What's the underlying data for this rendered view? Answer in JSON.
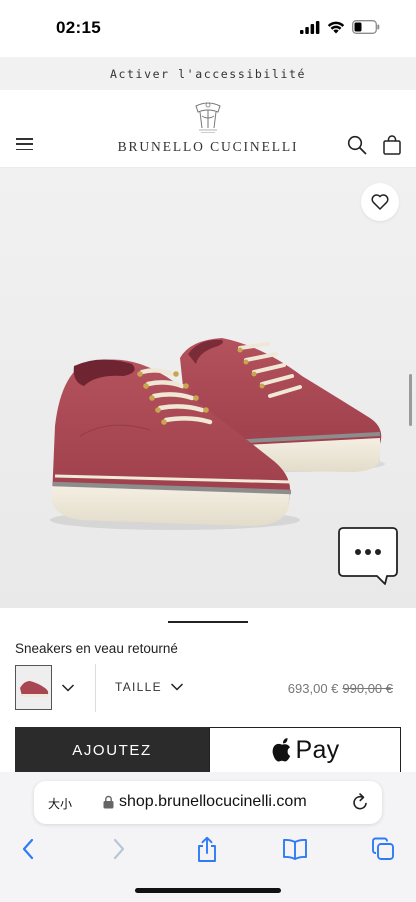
{
  "status_bar": {
    "time": "02:15"
  },
  "accessibility": {
    "label": "Activer l'accessibilité"
  },
  "header": {
    "brand": "BRUNELLO CUCINELLI"
  },
  "product": {
    "name": "Sneakers en veau retourné",
    "size_label": "TAILLE",
    "price_current": "693,00 €",
    "price_original": "990,00 €",
    "shoe_color": "#a84652"
  },
  "actions": {
    "add_label": "AJOUTEZ",
    "applepay_label": "Pay"
  },
  "browser": {
    "text_size_label": "大小",
    "url": "shop.brunellocucinelli.com",
    "accent_color": "#2f7bf6"
  }
}
